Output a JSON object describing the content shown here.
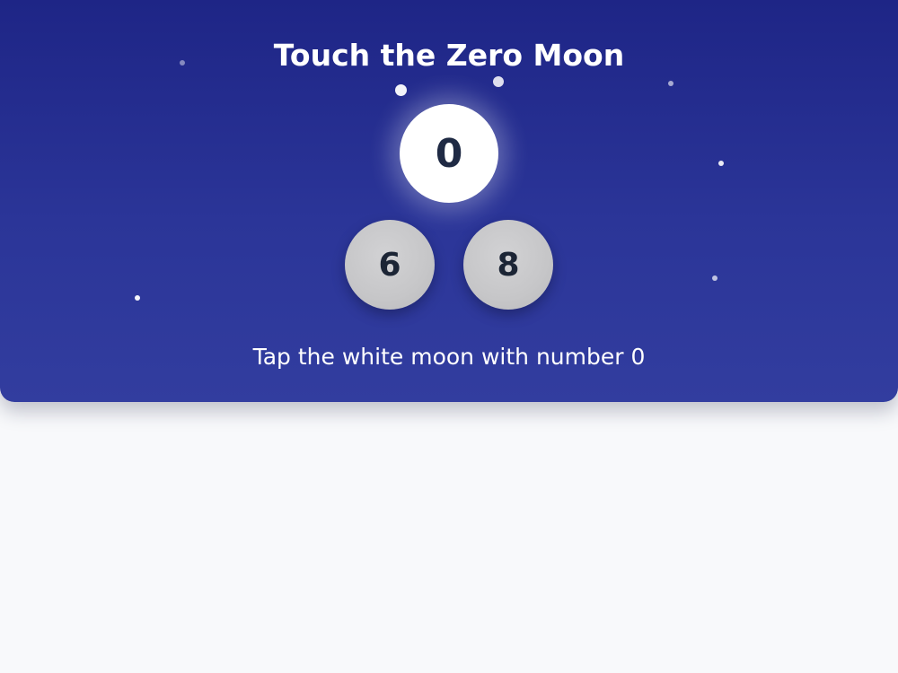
{
  "game": {
    "title": "Touch the Zero Moon",
    "instruction": "Tap the white moon with number 0"
  },
  "moons": {
    "target": {
      "number": "0",
      "color": "#ffffff"
    },
    "others": [
      {
        "number": "6",
        "color": "#c6c6c8"
      },
      {
        "number": "8",
        "color": "#c6c6c8"
      }
    ]
  },
  "theme": {
    "sky_top": "#1e2586",
    "sky_bottom": "#323d9f",
    "page_background": "#f8f9fb",
    "moon_text": "#1f2a44"
  }
}
